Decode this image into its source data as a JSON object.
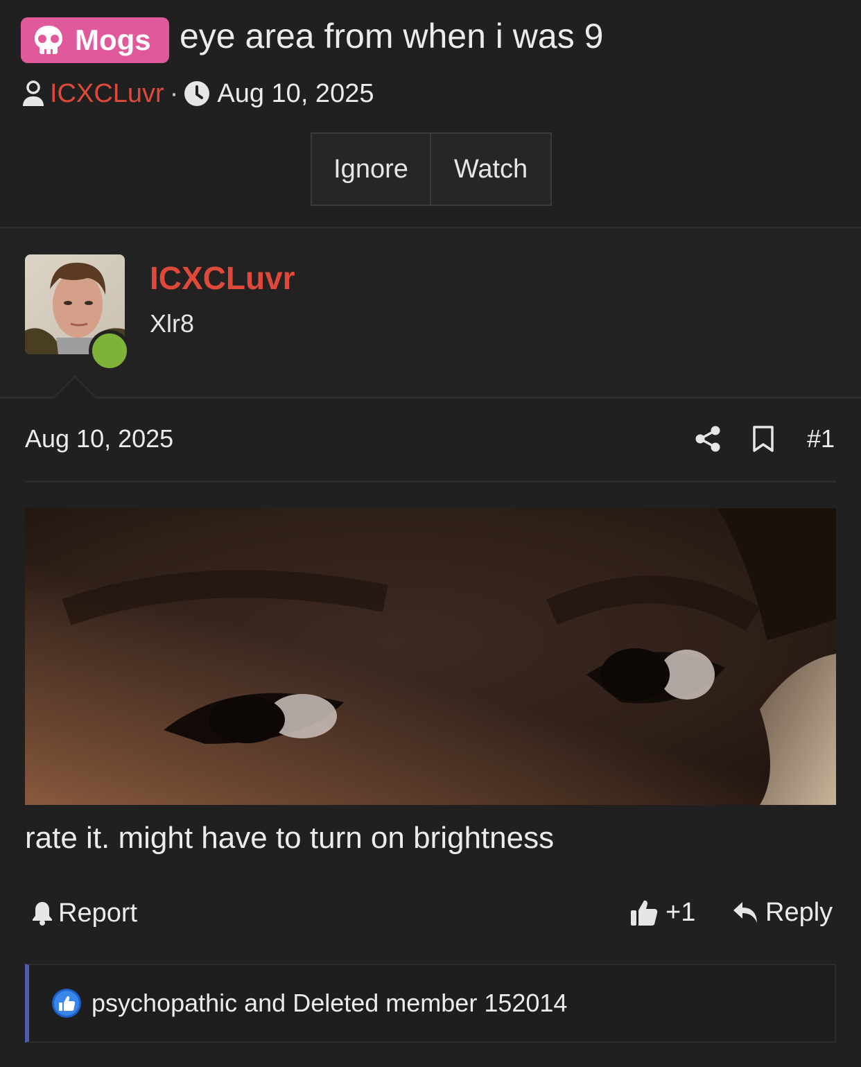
{
  "thread": {
    "prefix": "Mogs",
    "title": "eye area from when i was 9",
    "author": "ICXCLuvr",
    "separator": "·",
    "date": "Aug 10, 2025"
  },
  "actions": {
    "ignore": "Ignore",
    "watch": "Watch"
  },
  "post": {
    "username": "ICXCLuvr",
    "user_title": "Xlr8",
    "date": "Aug 10, 2025",
    "number": "#1",
    "body": "rate it. might have to turn on brightness",
    "report_label": "Report",
    "like_label": "+1",
    "reply_label": "Reply",
    "reactions_text": "psychopathic and Deleted member 152014"
  },
  "colors": {
    "background": "#202021",
    "prefix_pink": "#e05a9b",
    "username_red": "#e0493a",
    "online_green": "#7fb239",
    "reaction_bar": "#4d5cb0"
  },
  "icons": [
    "skull-icon",
    "user-icon",
    "clock-icon",
    "share-icon",
    "bookmark-icon",
    "bell-icon",
    "thumbs-up-icon",
    "reply-icon",
    "like-reaction-icon"
  ]
}
